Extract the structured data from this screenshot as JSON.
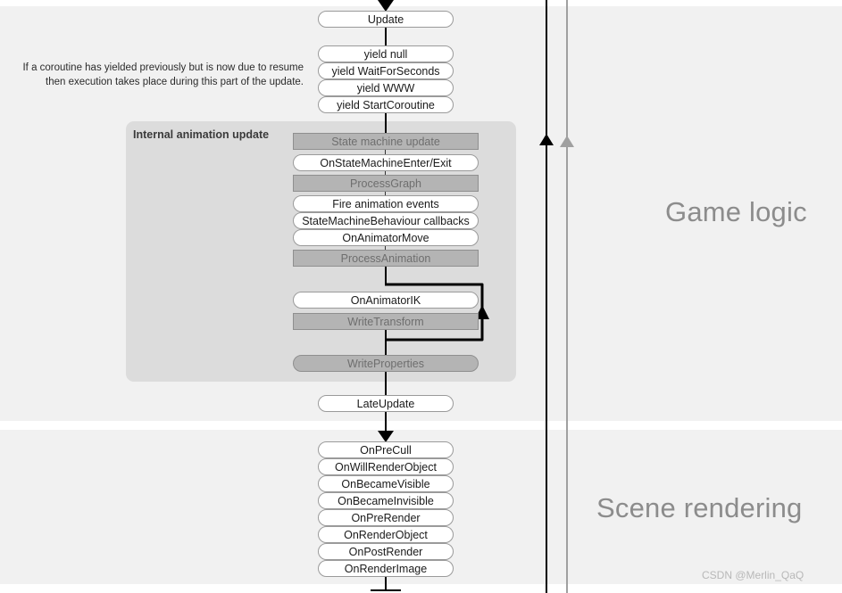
{
  "sections": [
    {
      "id": "game-logic",
      "label": "Game logic"
    },
    {
      "id": "scene-rendering",
      "label": "Scene rendering"
    }
  ],
  "note": "If a coroutine has yielded previously but is now due to resume then execution takes place during this part of the update.",
  "animation_panel": {
    "title": "Internal animation update"
  },
  "colors": {
    "band_background": "#f1f1f1",
    "panel_background": "#dcdcdc",
    "internal_box_fill": "#b4b4b4",
    "internal_box_text": "#6e6e6e",
    "callback_box_fill": "#ffffff",
    "callback_box_text": "#1a1a1a",
    "section_label": "#8c8c8c",
    "rail_black": "#000000",
    "rail_gray": "#a0a0a0",
    "watermark": "#b8b8b8"
  },
  "nodes": {
    "update": {
      "label": "Update",
      "kind": "callback"
    },
    "yield_null": {
      "label": "yield null",
      "kind": "callback"
    },
    "yield_waitforseconds": {
      "label": "yield WaitForSeconds",
      "kind": "callback"
    },
    "yield_www": {
      "label": "yield WWW",
      "kind": "callback"
    },
    "yield_startcoroutine": {
      "label": "yield StartCoroutine",
      "kind": "callback"
    },
    "state_machine_update": {
      "label": "State machine update",
      "kind": "internal"
    },
    "onstatemachineenterexit": {
      "label": "OnStateMachineEnter/Exit",
      "kind": "callback"
    },
    "processgraph": {
      "label": "ProcessGraph",
      "kind": "internal"
    },
    "fire_animation_events": {
      "label": "Fire animation events",
      "kind": "callback"
    },
    "statemachinebehaviour_callbacks": {
      "label": "StateMachineBehaviour callbacks",
      "kind": "callback"
    },
    "onanimatormove": {
      "label": "OnAnimatorMove",
      "kind": "callback"
    },
    "processanimation": {
      "label": "ProcessAnimation",
      "kind": "internal"
    },
    "onanimatorik": {
      "label": "OnAnimatorIK",
      "kind": "callback"
    },
    "writetransform": {
      "label": "WriteTransform",
      "kind": "internal"
    },
    "writeproperties": {
      "label": "WriteProperties",
      "kind": "internal-round"
    },
    "lateupdate": {
      "label": "LateUpdate",
      "kind": "callback"
    },
    "onprecull": {
      "label": "OnPreCull",
      "kind": "callback"
    },
    "onwillrenderobject": {
      "label": "OnWillRenderObject",
      "kind": "callback"
    },
    "onbecamevisible": {
      "label": "OnBecameVisible",
      "kind": "callback"
    },
    "onbecameinvisible": {
      "label": "OnBecameInvisible",
      "kind": "callback"
    },
    "onprerender": {
      "label": "OnPreRender",
      "kind": "callback"
    },
    "onrenderobject": {
      "label": "OnRenderObject",
      "kind": "callback"
    },
    "onpostrender": {
      "label": "OnPostRender",
      "kind": "callback"
    },
    "onrenderimage": {
      "label": "OnRenderImage",
      "kind": "callback"
    }
  },
  "watermark": "CSDN @Merlin_QaQ"
}
